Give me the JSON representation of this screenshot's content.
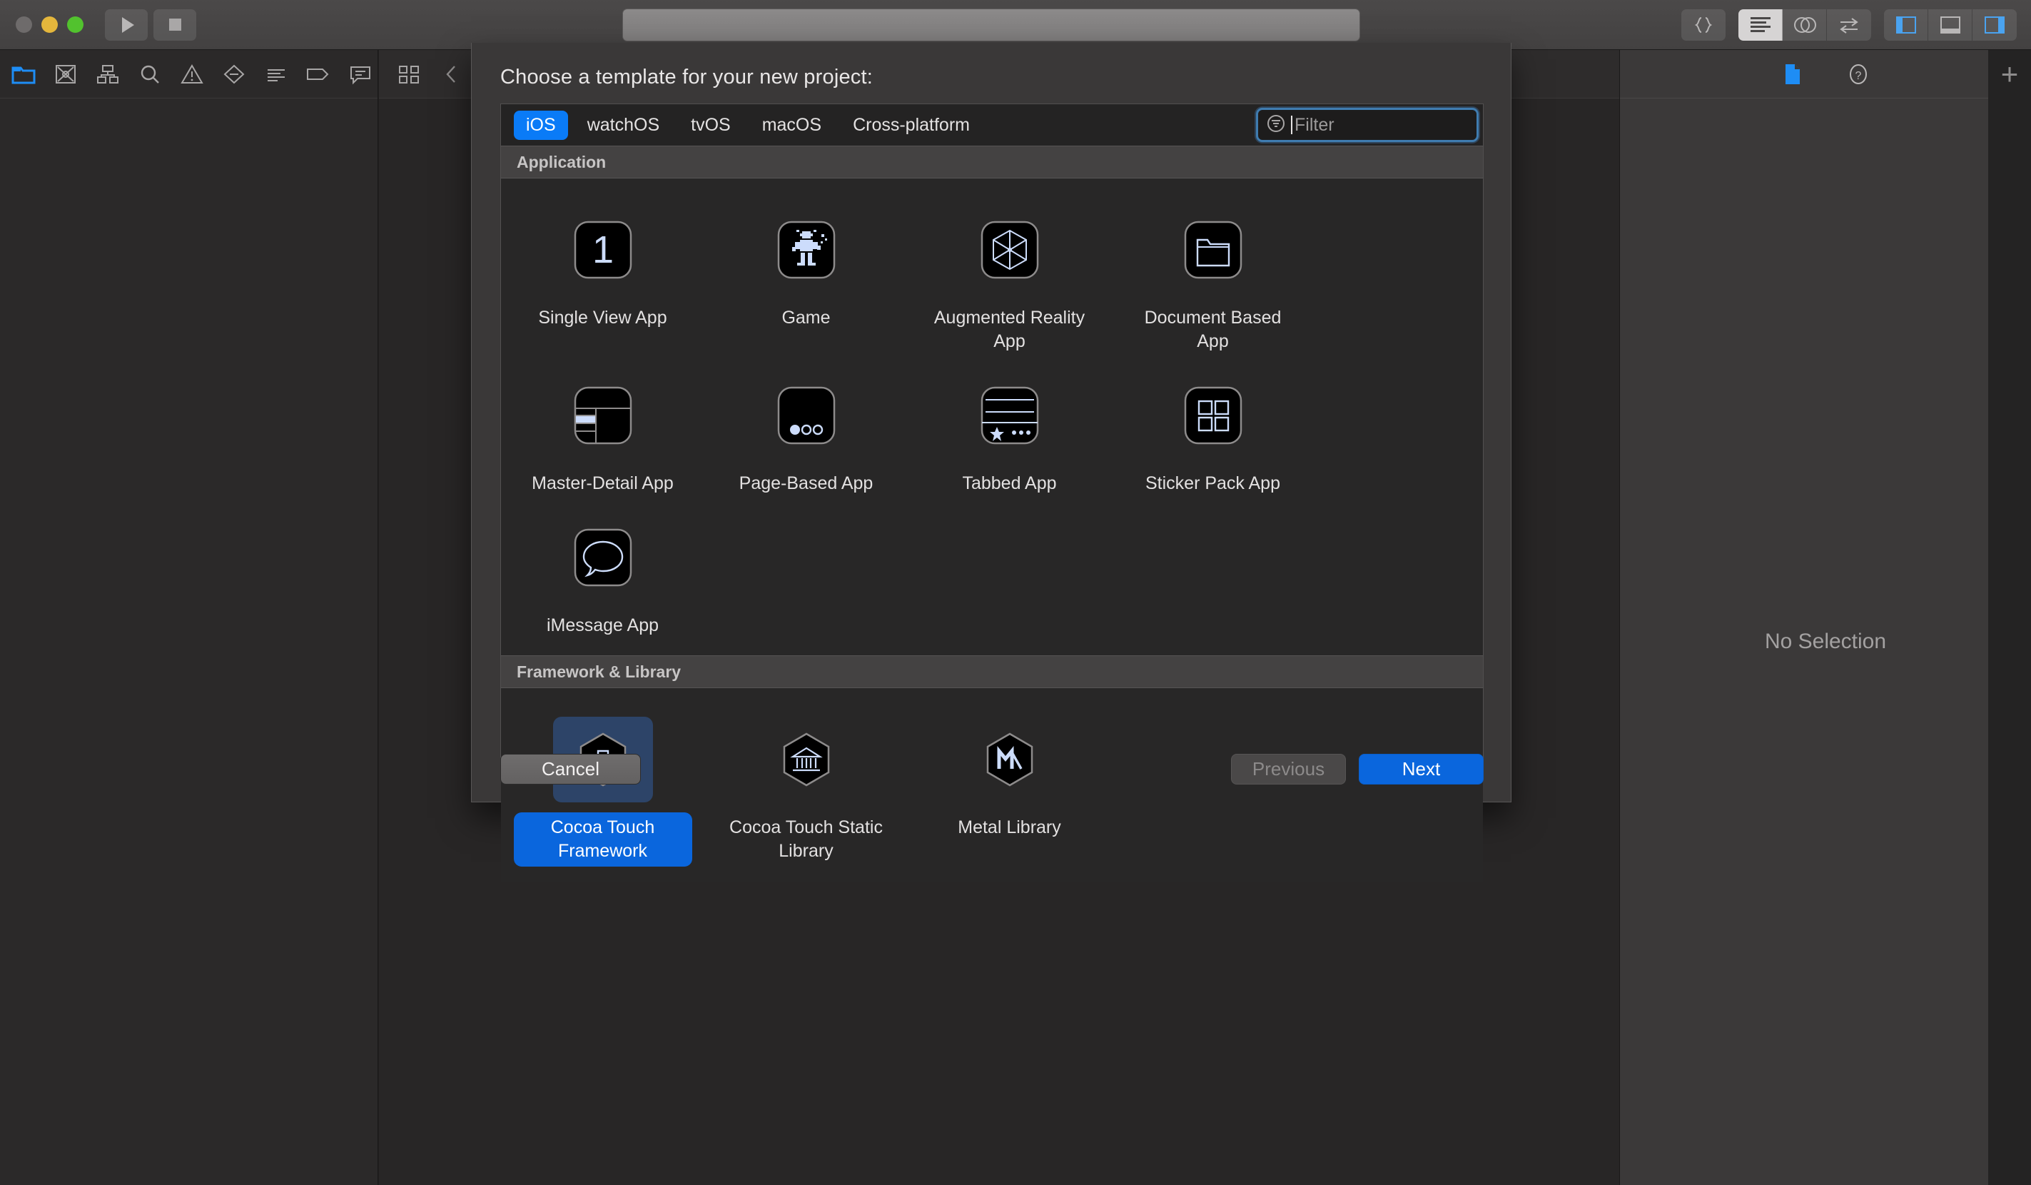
{
  "window": {
    "traffic_lights": [
      "close",
      "minimize",
      "zoom"
    ],
    "run_button": "run-icon",
    "stop_button": "stop-icon",
    "jumpbar_value": "",
    "right_tools": [
      "braces-icon",
      "standard-editor-icon",
      "assistant-editor-icon",
      "version-editor-icon",
      "left-panel-icon",
      "bottom-panel-icon",
      "right-panel-icon"
    ]
  },
  "navigator": {
    "icons": [
      "folder-icon",
      "source-control-icon",
      "symbol-icon",
      "search-icon",
      "warning-icon",
      "test-icon",
      "debug-icon",
      "breakpoint-icon",
      "report-icon"
    ]
  },
  "editor": {
    "icons": [
      "grid-icon",
      "chevron-left-icon",
      "chevron-right-icon"
    ]
  },
  "inspector": {
    "icons": [
      "file-inspector-icon",
      "quick-help-icon"
    ],
    "empty_text": "No Selection"
  },
  "far_right": {
    "add_label": "+"
  },
  "dialog": {
    "title": "Choose a template for your new project:",
    "tabs": [
      {
        "label": "iOS",
        "active": true
      },
      {
        "label": "watchOS",
        "active": false
      },
      {
        "label": "tvOS",
        "active": false
      },
      {
        "label": "macOS",
        "active": false
      },
      {
        "label": "Cross-platform",
        "active": false
      }
    ],
    "filter": {
      "placeholder": "Filter",
      "value": "",
      "icon": "filter-icon",
      "focused": true
    },
    "sections": [
      {
        "title": "Application",
        "items": [
          {
            "label": "Single View App",
            "icon": "single-view-icon",
            "selected": false
          },
          {
            "label": "Game",
            "icon": "game-robot-icon",
            "selected": false
          },
          {
            "label": "Augmented Reality App",
            "icon": "augmented-reality-icon",
            "selected": false
          },
          {
            "label": "Document Based App",
            "icon": "document-folder-icon",
            "selected": false
          },
          {
            "label": "Master-Detail App",
            "icon": "master-detail-icon",
            "selected": false
          },
          {
            "label": "Page-Based App",
            "icon": "page-based-icon",
            "selected": false
          },
          {
            "label": "Tabbed App",
            "icon": "tabbed-app-icon",
            "selected": false
          },
          {
            "label": "Sticker Pack App",
            "icon": "sticker-pack-icon",
            "selected": false
          },
          {
            "label": "iMessage App",
            "icon": "imessage-bubble-icon",
            "selected": false
          }
        ]
      },
      {
        "title": "Framework & Library",
        "items": [
          {
            "label": "Cocoa Touch Framework",
            "icon": "briefcase-hex-icon",
            "selected": true
          },
          {
            "label": "Cocoa Touch Static Library",
            "icon": "bank-hex-icon",
            "selected": false
          },
          {
            "label": "Metal Library",
            "icon": "metal-hex-icon",
            "selected": false
          }
        ]
      }
    ],
    "buttons": {
      "cancel": "Cancel",
      "previous": "Previous",
      "next": "Next",
      "previous_disabled": true
    }
  },
  "colors": {
    "accent_blue": "#0a7bf7",
    "button_blue": "#0a66dd",
    "selection_backdrop": "#2d4468",
    "icon_glyph": "#ccdcfb",
    "sheet_bg": "#3a3838",
    "picker_bg": "#282727"
  }
}
